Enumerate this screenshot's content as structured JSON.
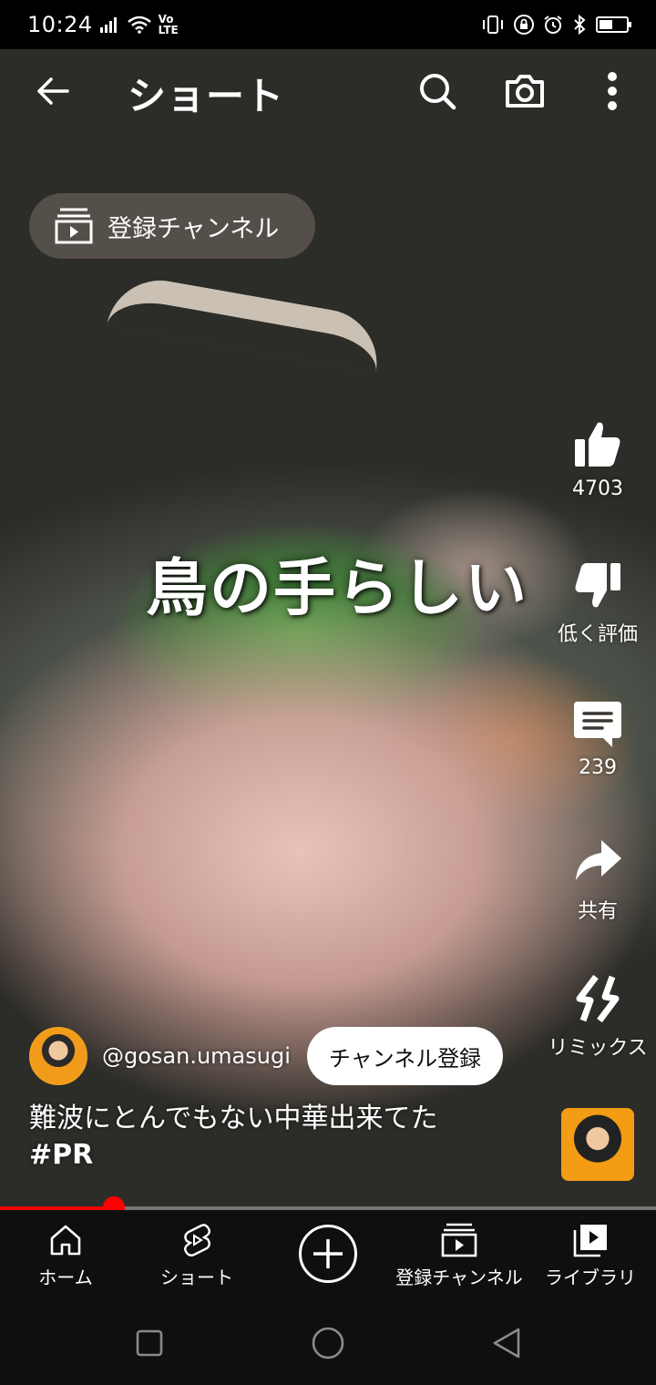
{
  "status_bar": {
    "time": "10:24",
    "network_label": "Vo LTE"
  },
  "header": {
    "title": "ショート",
    "subscriptions_pill": "登録チャンネル"
  },
  "video": {
    "overlay_text": "鳥の手らしい"
  },
  "actions": {
    "like_count": "4703",
    "dislike_label": "低く評価",
    "comment_count": "239",
    "share_label": "共有",
    "remix_label": "リミックス"
  },
  "channel": {
    "handle": "@gosan.umasugi",
    "subscribe_label": "チャンネル登録"
  },
  "caption": {
    "text": "難波にとんでもない中華出来てた",
    "hashtag": "#PR"
  },
  "progress": {
    "fraction": 0.174
  },
  "bottom_nav": {
    "home": "ホーム",
    "shorts": "ショート",
    "subscriptions": "登録チャンネル",
    "library": "ライブラリ"
  },
  "colors": {
    "accent": "#ff0000",
    "nav_background": "#0f0f0f"
  }
}
